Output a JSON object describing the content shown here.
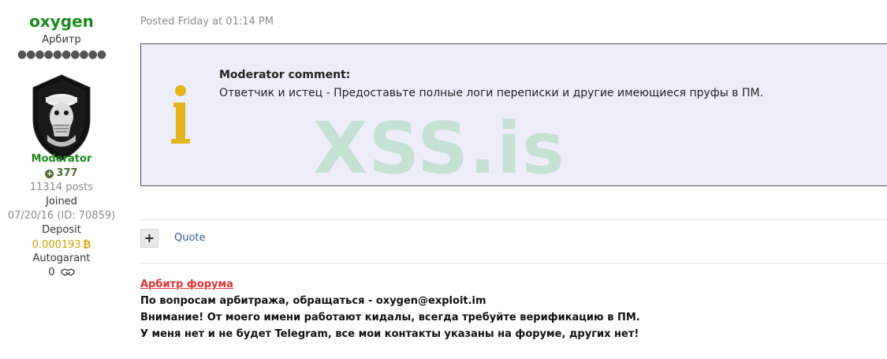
{
  "user": {
    "name": "oxygen",
    "title": "Арбитр",
    "rank_dots": "●●●●●●●●●●",
    "role": "Moderator",
    "reputation": "377",
    "posts": "11314 posts",
    "joined_label": "Joined",
    "joined_value": "07/20/16 (ID: 70859)",
    "deposit_label": "Deposit",
    "deposit_value": "0.000193",
    "autogarant_label": "Autogarant",
    "autogarant_value": "0"
  },
  "post": {
    "date": "Posted Friday at 01:14 PM",
    "moderator_box": {
      "title": "Moderator comment:",
      "text": "Ответчик и истец - Предоставьте полные логи переписки и другие имеющиеся пруфы в ПМ.",
      "watermark": "XSS.is"
    },
    "actions": {
      "plus_label": "+",
      "quote_label": "Quote"
    }
  },
  "signature": {
    "title": "Арбитр форума",
    "lines": [
      "По вопросам арбитража, обращаться - oxygen@exploit.im",
      "Внимание! От моего имени работают кидалы, всегда требуйте верификацию в ПМ.",
      "У меня нет и не будет Telegram, все мои контакты указаны на форуме, других нет!"
    ]
  },
  "colors": {
    "username": "#1a8a1a",
    "mod_box_bg": "#eeeefa",
    "info_icon": "#e3b41a",
    "watermark": "#78c88c",
    "sig_title": "#dd3333"
  },
  "icons": {
    "info": "info-icon",
    "reputation": "plus-circle-icon",
    "deposit": "bitcoin-icon",
    "autogarant": "handshake-icon"
  }
}
